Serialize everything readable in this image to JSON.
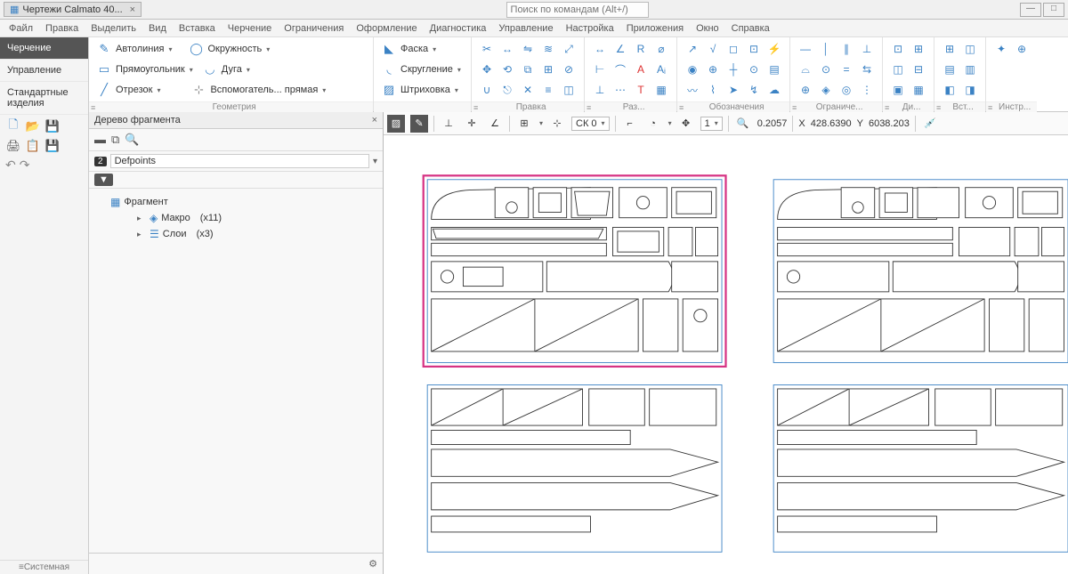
{
  "title": {
    "doc": "Чертежи Calmato 40..."
  },
  "search": {
    "placeholder": "Поиск по командам (Alt+/)"
  },
  "menu": [
    "Файл",
    "Правка",
    "Выделить",
    "Вид",
    "Вставка",
    "Черчение",
    "Ограничения",
    "Оформление",
    "Диагностика",
    "Управление",
    "Настройка",
    "Приложения",
    "Окно",
    "Справка"
  ],
  "leftTabs": {
    "active": "Черчение",
    "tab2": "Управление",
    "tab3": "Стандартные изделия",
    "sys": "Системная"
  },
  "ribbon": {
    "file": {
      "new": "□",
      "open": "📂",
      "save": "💾",
      "print": "🖨",
      "copy": "📋",
      "saveas": "💾"
    },
    "geom": {
      "autoline": "Автолиния",
      "rect": "Прямоугольник",
      "segment": "Отрезок",
      "circle": "Окружность",
      "arc": "Дуга",
      "helper": "Вспомогатель... прямая",
      "chamfer": "Фаска",
      "fillet": "Скругление",
      "hatch": "Штриховка",
      "label": "Геометрия"
    },
    "groups": {
      "edit": "Правка",
      "dim": "Раз...",
      "annot": "Обозначения",
      "constr": "Ограниче...",
      "diag": "Ди...",
      "ins": "Вст...",
      "tools": "Инстр..."
    }
  },
  "toolbar2": {
    "cs": "СК 0",
    "step": "1",
    "zoom": "0.2057",
    "xlabel": "X",
    "xval": "428.6390",
    "ylabel": "Y",
    "yval": "6038.203"
  },
  "tree": {
    "title": "Дерево фрагмента",
    "layerBadge": "2",
    "layerName": "Defpoints",
    "root": "Фрагмент",
    "macro": "Макро",
    "macroCount": "(x11)",
    "layers": "Слои",
    "layersCount": "(x3)"
  }
}
